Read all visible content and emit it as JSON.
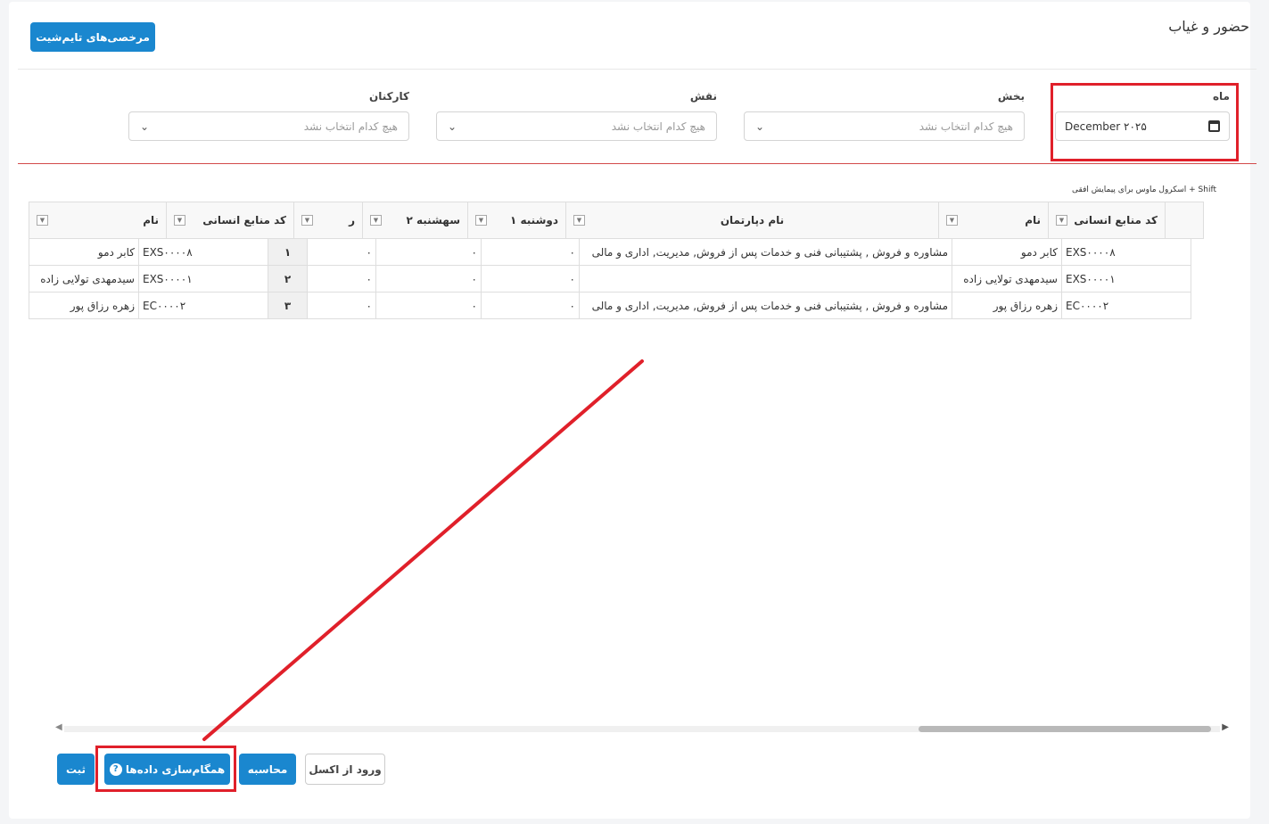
{
  "header": {
    "title": "حضور و غیاب",
    "timesheet_leave_button": "مرخصی‌های تایم‌شیت"
  },
  "filters": {
    "month": {
      "label": "ماه",
      "value": "December ۲۰۲۵",
      "icon": "calendar-icon"
    },
    "section": {
      "label": "بخش",
      "placeholder": "هیچ کدام انتخاب نشد"
    },
    "role": {
      "label": "نقش",
      "placeholder": "هیچ کدام انتخاب نشد"
    },
    "staff": {
      "label": "کارکنان",
      "placeholder": "هیچ کدام انتخاب نشد"
    }
  },
  "grid": {
    "hint": "Shift + اسکرول ماوس برای پیمایش افقی",
    "columns": [
      "کد منابع انسانی",
      "نام",
      "نام دپارتمان",
      "دوشنبه ۱",
      "سهشنبه ۲",
      "ﺭ",
      "کد منابع انسانی",
      "نام"
    ],
    "rows": [
      {
        "code": "EXS۰۰۰۰۸",
        "name": "کابر دمو",
        "dept": "مشاوره و فروش , پشتیبانی فنی و خدمات پس از فروش, مدیریت, اداری و مالی",
        "d1": "۰",
        "d2": "۰",
        "d3": "۰",
        "rownum": "۱",
        "code2": "EXS۰۰۰۰۸",
        "name2": "کابر دمو"
      },
      {
        "code": "EXS۰۰۰۰۱",
        "name": "سیدمهدی تولایی زاده",
        "dept": "",
        "d1": "۰",
        "d2": "۰",
        "d3": "۰",
        "rownum": "۲",
        "code2": "EXS۰۰۰۰۱",
        "name2": "سیدمهدی تولایی زاده"
      },
      {
        "code": "EC۰۰۰۰۲",
        "name": "زهره رزاق پور",
        "dept": "مشاوره و فروش , پشتیبانی فنی و خدمات پس از فروش, مدیریت, اداری و مالی",
        "d1": "۰",
        "d2": "۰",
        "d3": "۰",
        "rownum": "۳",
        "code2": "EC۰۰۰۰۲",
        "name2": "زهره رزاق پور"
      }
    ]
  },
  "actions": {
    "submit": "ثبت",
    "sync": "همگام‌سازی داده‌ها",
    "calculate": "محاسبه",
    "import_excel": "ورود از اکسل"
  },
  "colors": {
    "primary": "#1a87cf",
    "highlight": "#e0202a"
  }
}
